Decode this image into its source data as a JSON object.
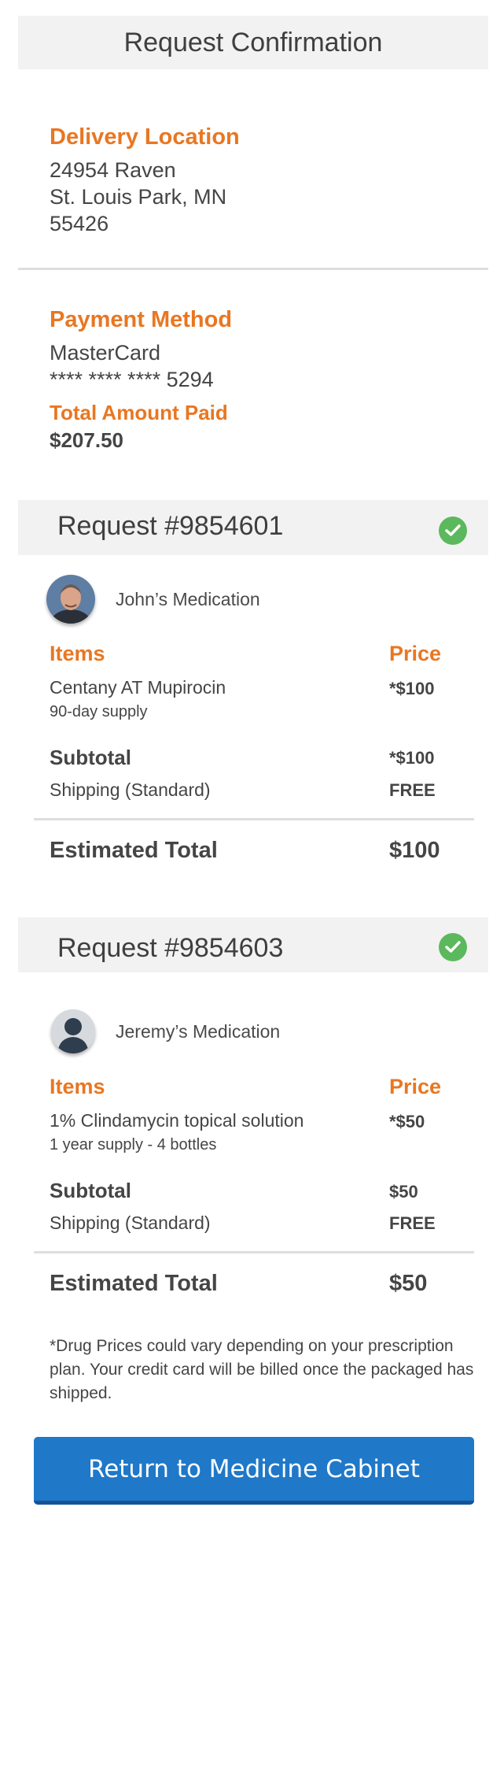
{
  "header": {
    "title": "Request Confirmation"
  },
  "delivery": {
    "title": "Delivery Location",
    "lines": [
      "24954 Raven",
      "St. Louis Park, MN",
      "55426"
    ]
  },
  "payment": {
    "title": "Payment Method",
    "card_type": "MasterCard",
    "card_number": "**** **** **** 5294",
    "total_label": "Total Amount Paid",
    "total_value": "$207.50"
  },
  "requests": [
    {
      "title": "Request #9854601",
      "patient": "John’s Medication",
      "items_label": "Items",
      "price_label": "Price",
      "item_name": "Centany AT Mupirocin",
      "item_sub": "90-day supply",
      "item_price": "*$100",
      "subtotal_label": "Subtotal",
      "subtotal_value": "*$100",
      "shipping_label": "Shipping (Standard)",
      "shipping_value": "FREE",
      "est_label": "Estimated Total",
      "est_value": "$100"
    },
    {
      "title": "Request #9854603",
      "patient": "Jeremy’s Medication",
      "items_label": "Items",
      "price_label": "Price",
      "item_name": "1% Clindamycin topical solution",
      "item_sub": "1 year supply - 4 bottles",
      "item_price": "*$50",
      "subtotal_label": "Subtotal",
      "subtotal_value": "$50",
      "shipping_label": "Shipping (Standard)",
      "shipping_value": "FREE",
      "est_label": "Estimated Total",
      "est_value": "$50"
    }
  ],
  "footnote": "*Drug Prices could vary depending on your prescription plan. Your credit card will be billed once the packaged has shipped.",
  "cta": {
    "label": "Return to Medicine Cabinet"
  },
  "colors": {
    "accent": "#e87722",
    "button": "#1f78c8",
    "check": "#5cb85c"
  }
}
